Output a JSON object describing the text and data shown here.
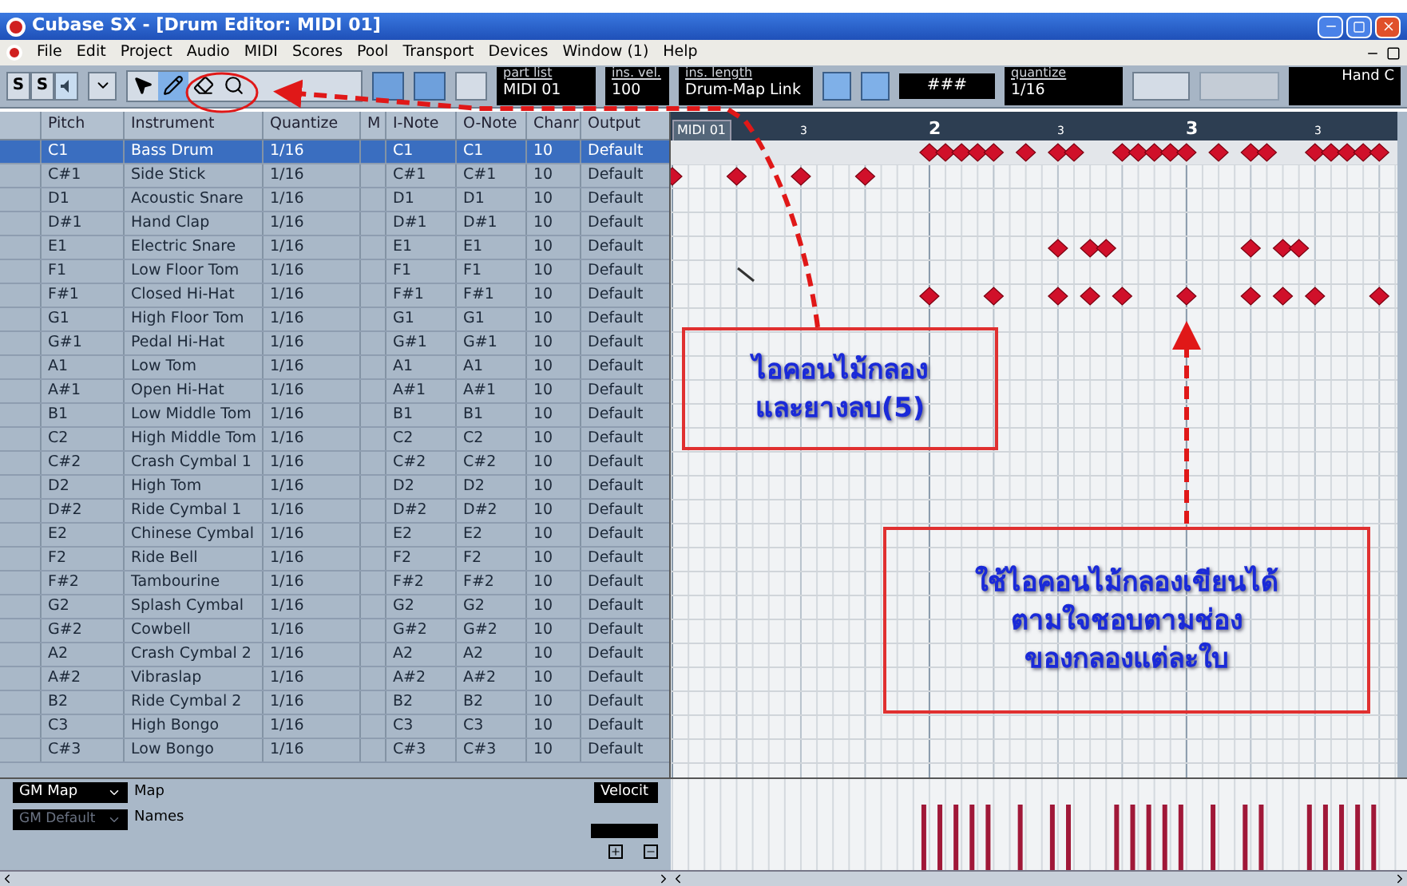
{
  "window": {
    "title": "Cubase SX - [Drum Editor: MIDI 01]"
  },
  "menu": [
    "File",
    "Edit",
    "Project",
    "Audio",
    "MIDI",
    "Scores",
    "Pool",
    "Transport",
    "Devices",
    "Window (1)",
    "Help"
  ],
  "toolbar": {
    "solo": [
      {
        "label": "S",
        "selected": false
      },
      {
        "label": "S",
        "selected": false
      }
    ],
    "tools": [
      {
        "kind": "pointer",
        "selected": false
      },
      {
        "kind": "drumstick",
        "selected": true
      },
      {
        "kind": "eraser",
        "selected": false
      },
      {
        "kind": "zoom",
        "selected": false
      }
    ],
    "part_list": {
      "label": "part list",
      "value": "MIDI 01"
    },
    "ins_vel": {
      "label": "ins. vel.",
      "value": "100"
    },
    "ins_length": {
      "label": "ins. length",
      "value": "Drum-Map Link"
    },
    "grid_value": "###",
    "quantize": {
      "label": "quantize",
      "value": "1/16"
    },
    "hand": "Hand C"
  },
  "table": {
    "columns": [
      "Pitch",
      "Instrument",
      "Quantize",
      "M",
      "I-Note",
      "O-Note",
      "Chanr",
      "Output"
    ],
    "rows": [
      {
        "pitch": "C1",
        "instrument": "Bass Drum",
        "quantize": "1/16",
        "i_note": "C1",
        "o_note": "C1",
        "channel": "10",
        "output": "Default",
        "selected": true
      },
      {
        "pitch": "C#1",
        "instrument": "Side Stick",
        "quantize": "1/16",
        "i_note": "C#1",
        "o_note": "C#1",
        "channel": "10",
        "output": "Default",
        "selected": false
      },
      {
        "pitch": "D1",
        "instrument": "Acoustic Snare",
        "quantize": "1/16",
        "i_note": "D1",
        "o_note": "D1",
        "channel": "10",
        "output": "Default",
        "selected": false
      },
      {
        "pitch": "D#1",
        "instrument": "Hand Clap",
        "quantize": "1/16",
        "i_note": "D#1",
        "o_note": "D#1",
        "channel": "10",
        "output": "Default",
        "selected": false
      },
      {
        "pitch": "E1",
        "instrument": "Electric Snare",
        "quantize": "1/16",
        "i_note": "E1",
        "o_note": "E1",
        "channel": "10",
        "output": "Default",
        "selected": false
      },
      {
        "pitch": "F1",
        "instrument": "Low Floor Tom",
        "quantize": "1/16",
        "i_note": "F1",
        "o_note": "F1",
        "channel": "10",
        "output": "Default",
        "selected": false
      },
      {
        "pitch": "F#1",
        "instrument": "Closed Hi-Hat",
        "quantize": "1/16",
        "i_note": "F#1",
        "o_note": "F#1",
        "channel": "10",
        "output": "Default",
        "selected": false
      },
      {
        "pitch": "G1",
        "instrument": "High Floor Tom",
        "quantize": "1/16",
        "i_note": "G1",
        "o_note": "G1",
        "channel": "10",
        "output": "Default",
        "selected": false
      },
      {
        "pitch": "G#1",
        "instrument": "Pedal Hi-Hat",
        "quantize": "1/16",
        "i_note": "G#1",
        "o_note": "G#1",
        "channel": "10",
        "output": "Default",
        "selected": false
      },
      {
        "pitch": "A1",
        "instrument": "Low Tom",
        "quantize": "1/16",
        "i_note": "A1",
        "o_note": "A1",
        "channel": "10",
        "output": "Default",
        "selected": false
      },
      {
        "pitch": "A#1",
        "instrument": "Open Hi-Hat",
        "quantize": "1/16",
        "i_note": "A#1",
        "o_note": "A#1",
        "channel": "10",
        "output": "Default",
        "selected": false
      },
      {
        "pitch": "B1",
        "instrument": "Low Middle Tom",
        "quantize": "1/16",
        "i_note": "B1",
        "o_note": "B1",
        "channel": "10",
        "output": "Default",
        "selected": false
      },
      {
        "pitch": "C2",
        "instrument": "High Middle Tom",
        "quantize": "1/16",
        "i_note": "C2",
        "o_note": "C2",
        "channel": "10",
        "output": "Default",
        "selected": false
      },
      {
        "pitch": "C#2",
        "instrument": "Crash Cymbal 1",
        "quantize": "1/16",
        "i_note": "C#2",
        "o_note": "C#2",
        "channel": "10",
        "output": "Default",
        "selected": false
      },
      {
        "pitch": "D2",
        "instrument": "High Tom",
        "quantize": "1/16",
        "i_note": "D2",
        "o_note": "D2",
        "channel": "10",
        "output": "Default",
        "selected": false
      },
      {
        "pitch": "D#2",
        "instrument": "Ride Cymbal 1",
        "quantize": "1/16",
        "i_note": "D#2",
        "o_note": "D#2",
        "channel": "10",
        "output": "Default",
        "selected": false
      },
      {
        "pitch": "E2",
        "instrument": "Chinese Cymbal",
        "quantize": "1/16",
        "i_note": "E2",
        "o_note": "E2",
        "channel": "10",
        "output": "Default",
        "selected": false
      },
      {
        "pitch": "F2",
        "instrument": "Ride Bell",
        "quantize": "1/16",
        "i_note": "F2",
        "o_note": "F2",
        "channel": "10",
        "output": "Default",
        "selected": false
      },
      {
        "pitch": "F#2",
        "instrument": "Tambourine",
        "quantize": "1/16",
        "i_note": "F#2",
        "o_note": "F#2",
        "channel": "10",
        "output": "Default",
        "selected": false
      },
      {
        "pitch": "G2",
        "instrument": "Splash Cymbal",
        "quantize": "1/16",
        "i_note": "G2",
        "o_note": "G2",
        "channel": "10",
        "output": "Default",
        "selected": false
      },
      {
        "pitch": "G#2",
        "instrument": "Cowbell",
        "quantize": "1/16",
        "i_note": "G#2",
        "o_note": "G#2",
        "channel": "10",
        "output": "Default",
        "selected": false
      },
      {
        "pitch": "A2",
        "instrument": "Crash Cymbal 2",
        "quantize": "1/16",
        "i_note": "A2",
        "o_note": "A2",
        "channel": "10",
        "output": "Default",
        "selected": false
      },
      {
        "pitch": "A#2",
        "instrument": "Vibraslap",
        "quantize": "1/16",
        "i_note": "A#2",
        "o_note": "A#2",
        "channel": "10",
        "output": "Default",
        "selected": false
      },
      {
        "pitch": "B2",
        "instrument": "Ride Cymbal 2",
        "quantize": "1/16",
        "i_note": "B2",
        "o_note": "B2",
        "channel": "10",
        "output": "Default",
        "selected": false
      },
      {
        "pitch": "C3",
        "instrument": "High Bongo",
        "quantize": "1/16",
        "i_note": "C3",
        "o_note": "C3",
        "channel": "10",
        "output": "Default",
        "selected": false
      },
      {
        "pitch": "C#3",
        "instrument": "Low Bongo",
        "quantize": "1/16",
        "i_note": "C#3",
        "o_note": "C#3",
        "channel": "10",
        "output": "Default",
        "selected": false
      }
    ]
  },
  "ruler": {
    "part": "MIDI 01",
    "marks": [
      {
        "label": "3",
        "kind": "beat"
      },
      {
        "label": "2",
        "kind": "bar"
      },
      {
        "label": "3",
        "kind": "beat"
      },
      {
        "label": "3",
        "kind": "bar"
      },
      {
        "label": "3",
        "kind": "beat"
      }
    ]
  },
  "bottom": {
    "map": {
      "value": "GM Map",
      "label": "Map"
    },
    "names": {
      "value": "GM Default",
      "label": "Names",
      "disabled": true
    },
    "lane": "Velocit"
  },
  "callouts": [
    {
      "lines": [
        "ไอคอนไม้กลอง",
        "และยางลบ(5)"
      ]
    },
    {
      "lines": [
        "ใช้ไอคอนไม้กลองเขียนได้",
        "ตามใจชอบตามช่อง",
        "ของกลองแต่ละใบ"
      ]
    }
  ]
}
